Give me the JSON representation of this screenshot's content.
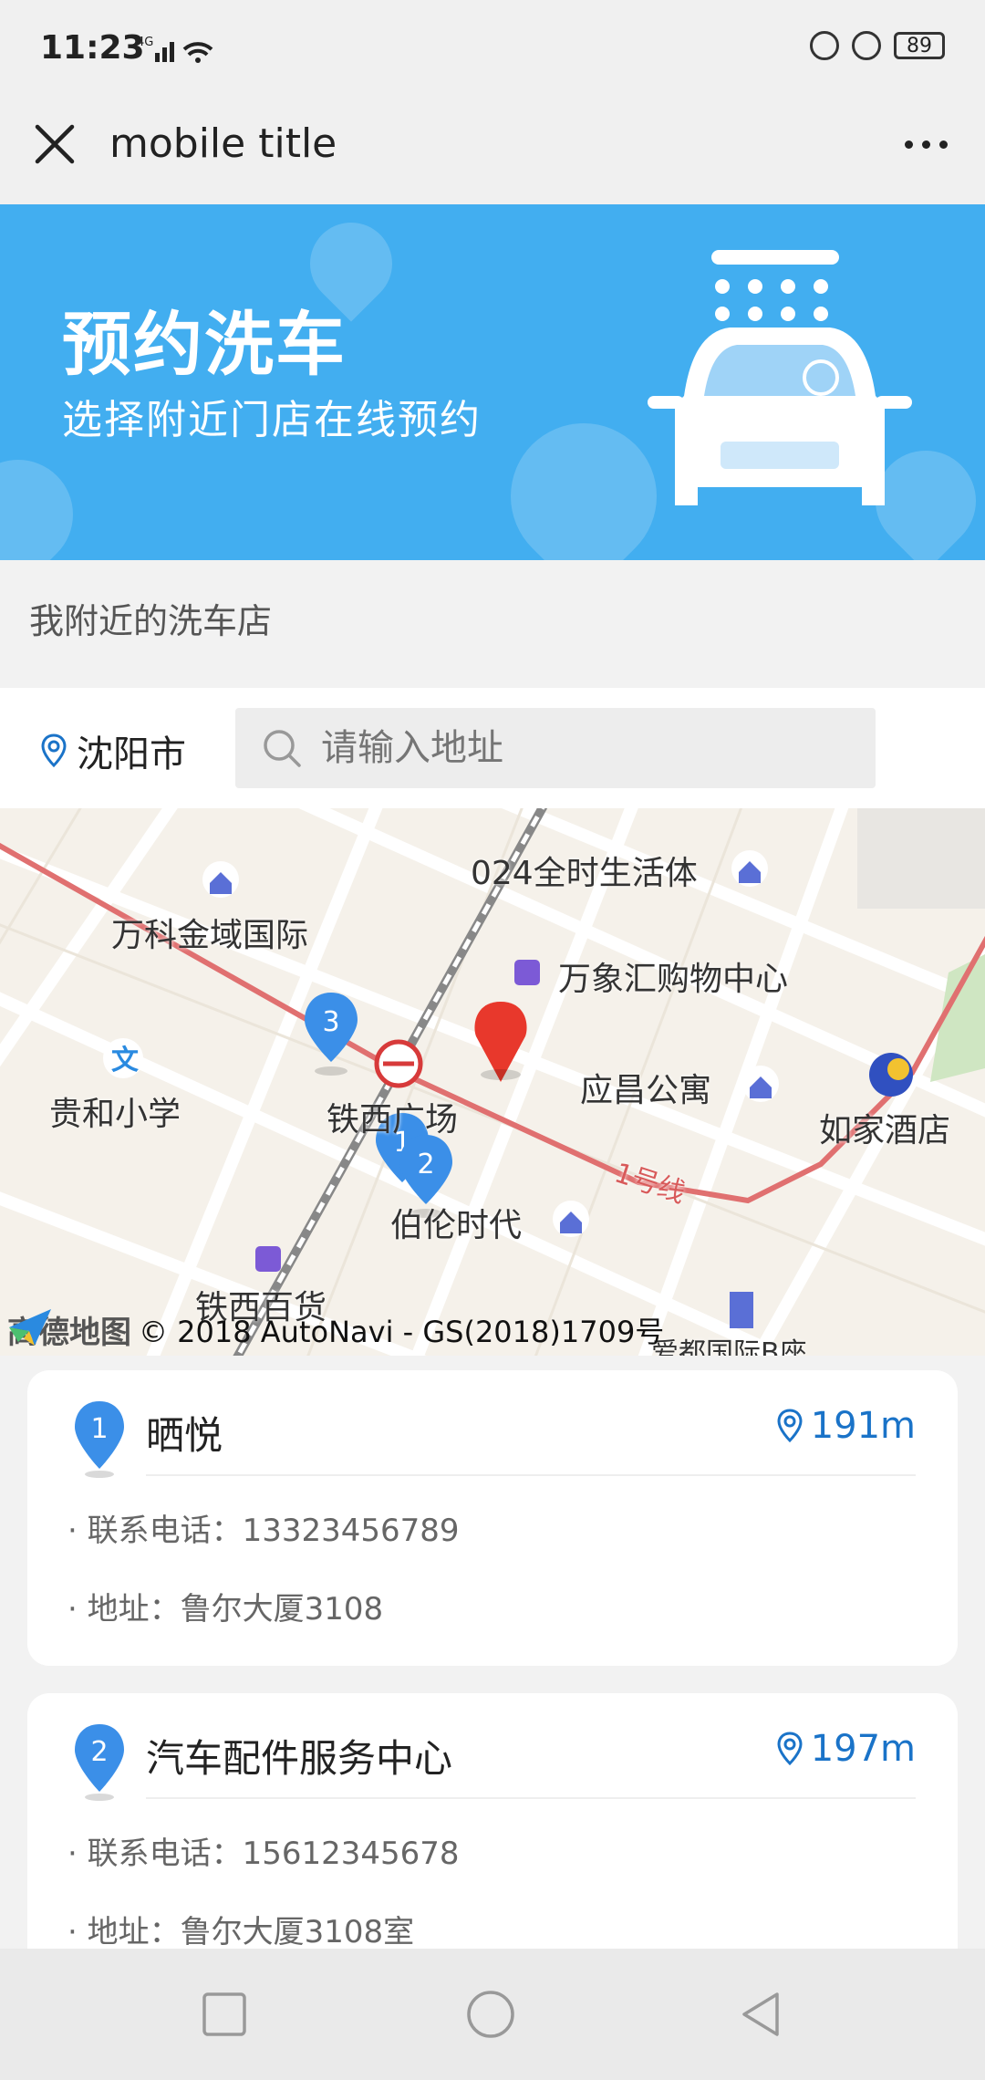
{
  "status_bar": {
    "time": "11:23",
    "network": "4G",
    "battery": "89"
  },
  "header": {
    "title": "mobile title"
  },
  "banner": {
    "title": "预约洗车",
    "subtitle": "选择附近门店在线预约"
  },
  "section": {
    "label": "我附近的洗车店"
  },
  "search": {
    "city": "沈阳市",
    "placeholder": "请输入地址"
  },
  "map": {
    "labels": {
      "l1": "万科金域国际",
      "l2": "024全时生活体",
      "l3": "万象汇购物中心",
      "l4": "贵和小学",
      "l5": "铁西广场",
      "l6": "应昌公寓",
      "l7": "如家酒店",
      "l8": "伯伦时代",
      "l9": "铁西百货",
      "l10": "1号线",
      "l11": "爱都国际B座"
    },
    "pins": [
      "1",
      "2",
      "3"
    ],
    "provider": "高德地图",
    "copyright": "© 2018 AutoNavi - GS(2018)1709号"
  },
  "stores": [
    {
      "index": "1",
      "name": "晒悦",
      "distance": "191m",
      "phone": "· 联系电话：13323456789",
      "address": "· 地址：鲁尔大厦3108"
    },
    {
      "index": "2",
      "name": "汽车配件服务中心",
      "distance": "197m",
      "phone": "· 联系电话：15612345678",
      "address": "· 地址：鲁尔大厦3108室"
    }
  ],
  "colors": {
    "accent": "#1a73c8",
    "banner": "#42aef0",
    "pin": "#3b8fe8",
    "marker": "#e8382c"
  }
}
